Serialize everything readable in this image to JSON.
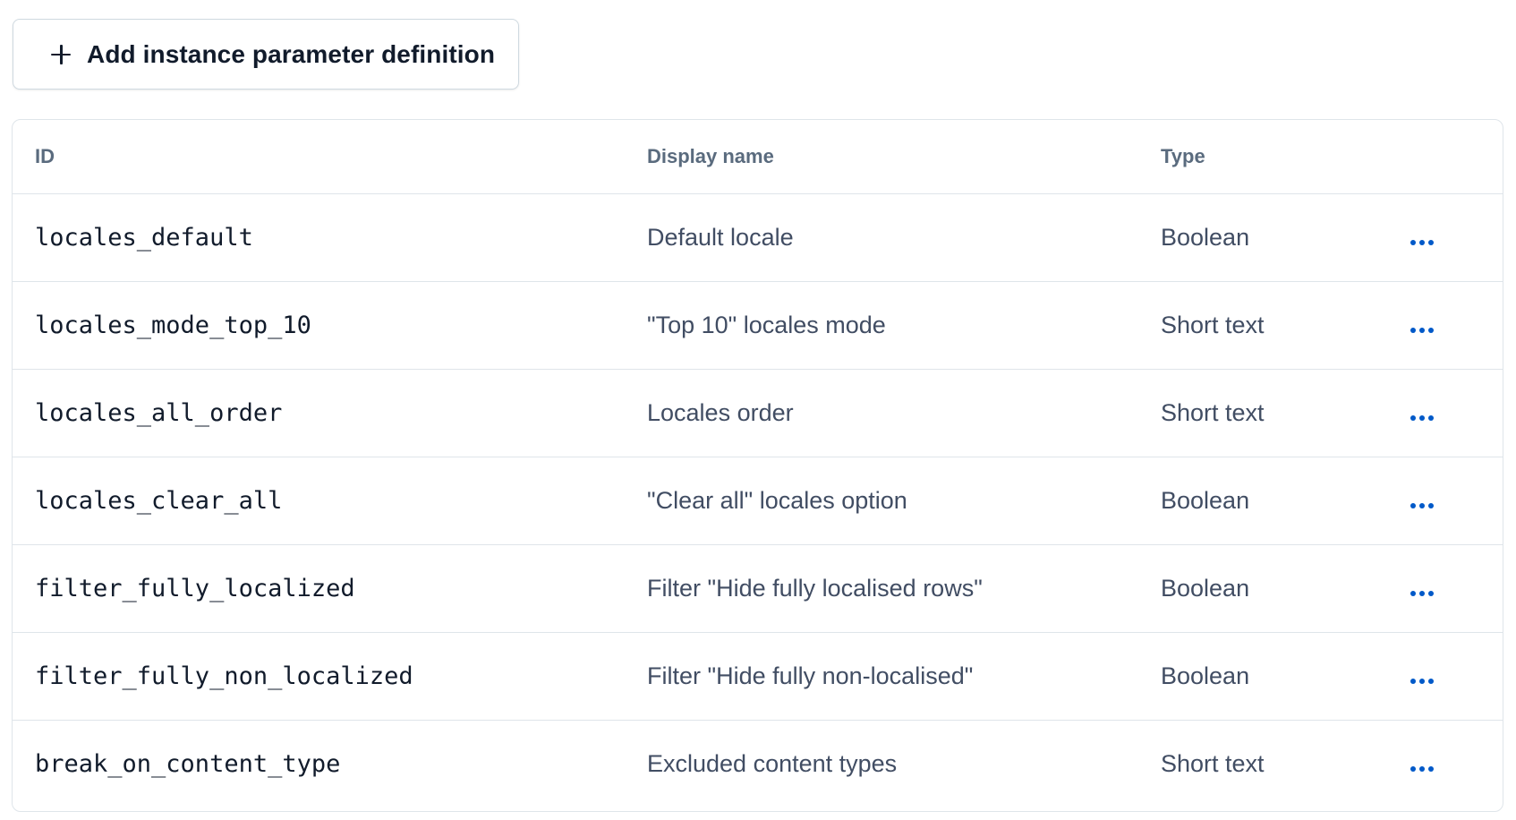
{
  "toolbar": {
    "add_label": "Add instance parameter definition"
  },
  "table": {
    "columns": {
      "id": "ID",
      "display_name": "Display name",
      "type": "Type"
    },
    "rows": [
      {
        "id": "locales_default",
        "display_name": "Default locale",
        "type": "Boolean"
      },
      {
        "id": "locales_mode_top_10",
        "display_name": "\"Top 10\" locales mode",
        "type": "Short text"
      },
      {
        "id": "locales_all_order",
        "display_name": "Locales order",
        "type": "Short text"
      },
      {
        "id": "locales_clear_all",
        "display_name": "\"Clear all\" locales option",
        "type": "Boolean"
      },
      {
        "id": "filter_fully_localized",
        "display_name": "Filter \"Hide fully localised rows\"",
        "type": "Boolean"
      },
      {
        "id": "filter_fully_non_localized",
        "display_name": "Filter \"Hide fully non-localised\"",
        "type": "Boolean"
      },
      {
        "id": "break_on_content_type",
        "display_name": "Excluded content types",
        "type": "Short text"
      }
    ]
  },
  "colors": {
    "accent": "#0059c8",
    "text_primary": "#111b2b",
    "text_secondary": "#414d63",
    "header_text": "#5a6b7e",
    "border": "#dfe5ea"
  },
  "icons": {
    "add": "plus-icon",
    "row_action": "more-options-icon"
  }
}
